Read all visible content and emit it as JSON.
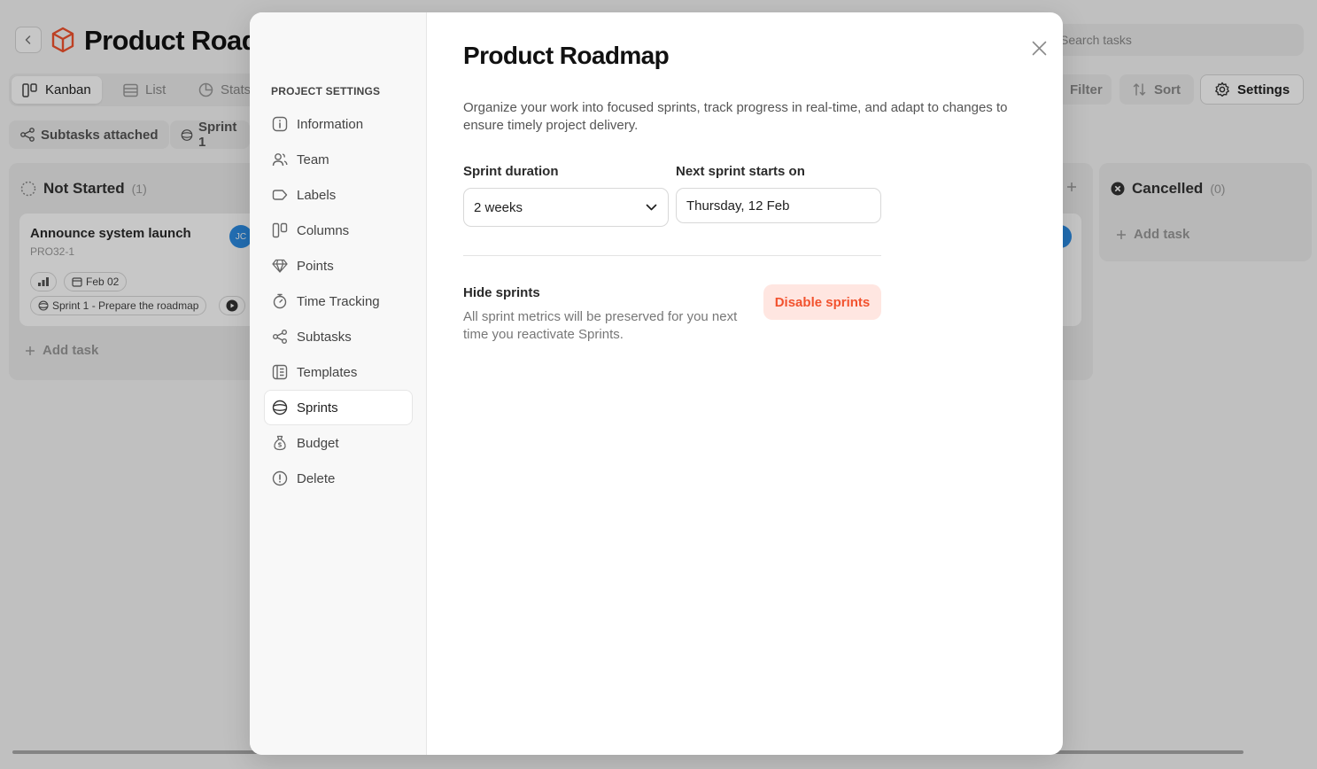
{
  "app": {
    "title": "Product Roadmap",
    "search_placeholder": "Search tasks",
    "view_tabs": [
      {
        "label": "Kanban",
        "icon": "columns-icon",
        "active": true
      },
      {
        "label": "List",
        "icon": "list-icon",
        "active": false
      },
      {
        "label": "Stats",
        "icon": "chart-icon",
        "active": false
      }
    ],
    "toolbar": {
      "filter": "Filter",
      "sort": "Sort",
      "settings": "Settings"
    },
    "chips": {
      "subtasks": "Subtasks attached",
      "sprint": "Sprint 1"
    },
    "columns": [
      {
        "name": "Not Started",
        "count": "(1)",
        "card": {
          "title": "Announce system launch",
          "id": "PRO32-1",
          "avatar": "JC",
          "date": "Feb 02",
          "sprint": "Sprint 1 - Prepare the roadmap"
        },
        "add_task": "Add task"
      },
      {
        "name": "Cancelled",
        "count": "(0)",
        "add_task": "Add task"
      }
    ]
  },
  "modal": {
    "section_heading": "PROJECT SETTINGS",
    "nav": [
      {
        "label": "Information",
        "icon": "info-icon"
      },
      {
        "label": "Team",
        "icon": "users-icon"
      },
      {
        "label": "Labels",
        "icon": "label-icon"
      },
      {
        "label": "Columns",
        "icon": "columns-icon"
      },
      {
        "label": "Points",
        "icon": "diamond-icon"
      },
      {
        "label": "Time Tracking",
        "icon": "stopwatch-icon"
      },
      {
        "label": "Subtasks",
        "icon": "subtasks-icon"
      },
      {
        "label": "Templates",
        "icon": "template-icon"
      },
      {
        "label": "Sprints",
        "icon": "sprint-icon",
        "active": true
      },
      {
        "label": "Budget",
        "icon": "money-bag-icon"
      },
      {
        "label": "Delete",
        "icon": "alert-circle-icon"
      }
    ],
    "title": "Product Roadmap",
    "description": "Organize your work into focused sprints, track progress in real-time, and adapt to changes to ensure timely project delivery.",
    "sprint_duration": {
      "label": "Sprint duration",
      "value": "2 weeks"
    },
    "next_sprint": {
      "label": "Next sprint starts on",
      "value": "Thursday, 12 Feb"
    },
    "hide_sprints": {
      "title": "Hide sprints",
      "description": "All sprint metrics will be preserved for you next time you reactivate Sprints.",
      "button": "Disable sprints"
    }
  },
  "colors": {
    "danger": "#f2522e",
    "danger_bg": "#ffe6e1",
    "overlay": "rgba(0,0,0,0.22)"
  }
}
